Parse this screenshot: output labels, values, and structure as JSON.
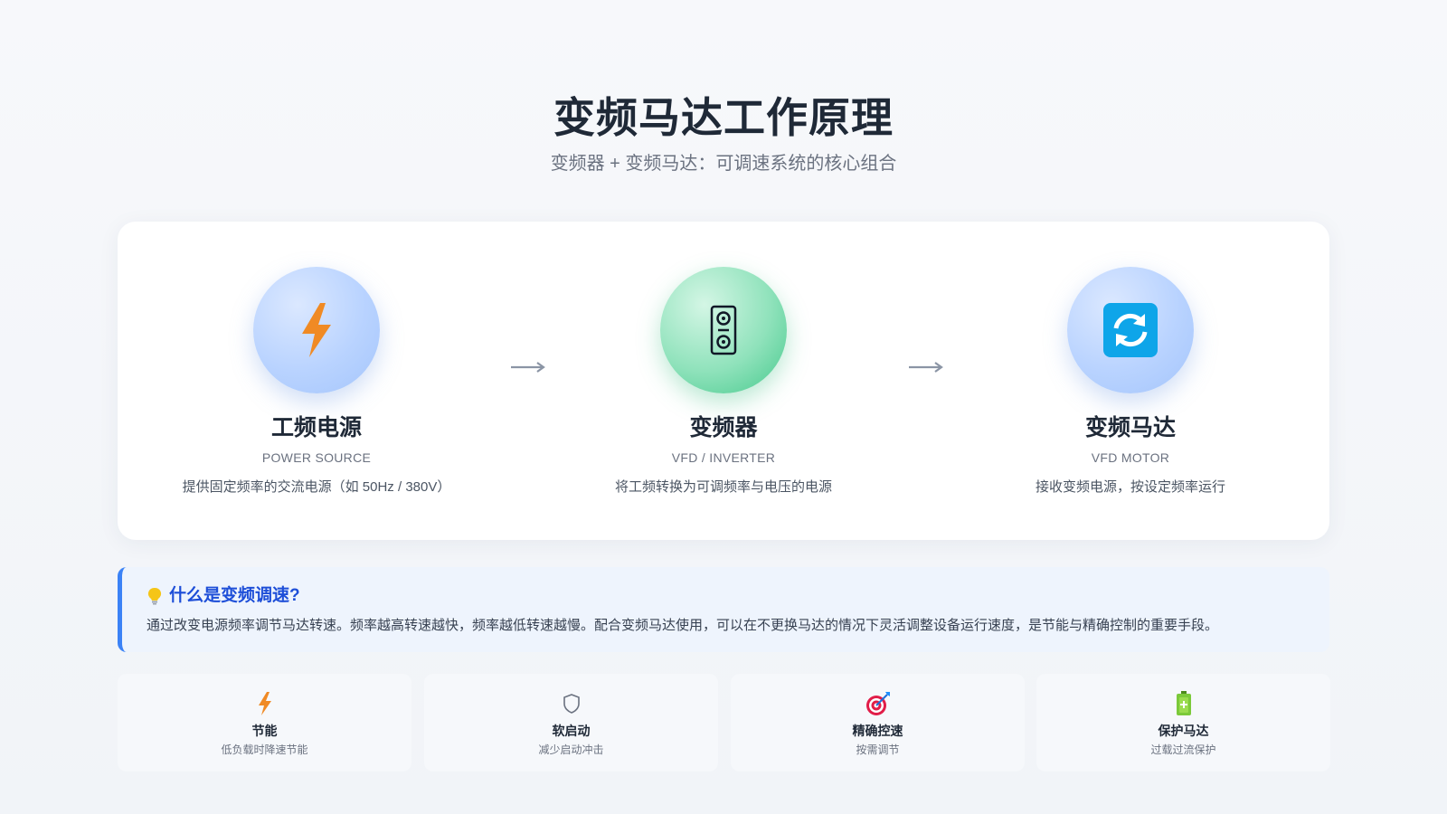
{
  "header": {
    "title": "变频马达工作原理",
    "subtitle": "变频器 + 变频马达：可调速系统的核心组合"
  },
  "flow": {
    "arrow_symbol": "→",
    "steps": [
      {
        "name": "工频电源",
        "en": "POWER SOURCE",
        "desc": "提供固定频率的交流电源（如 50Hz / 380V）",
        "icon": "lightning-icon",
        "accent": "#f08a24"
      },
      {
        "name": "变频器",
        "en": "VFD / INVERTER",
        "desc": "将工频转换为可调频率与电压的电源",
        "icon": "control-knobs-icon",
        "accent": "#2fbf7f"
      },
      {
        "name": "变频马达",
        "en": "VFD MOTOR",
        "desc": "接收变频电源，按设定频率运行",
        "icon": "refresh-icon",
        "accent": "#0ea5e9"
      }
    ]
  },
  "note": {
    "icon": "lightbulb-icon",
    "title": "什么是变频调速?",
    "text": "通过改变电源频率调节马达转速。频率越高转速越快，频率越低转速越慢。配合变频马达使用，可以在不更换马达的情况下灵活调整设备运行速度，是节能与精确控制的重要手段。"
  },
  "features": [
    {
      "name": "节能",
      "desc": "低负载时降速节能",
      "icon": "lightning-icon"
    },
    {
      "name": "软启动",
      "desc": "减少启动冲击",
      "icon": "shield-icon"
    },
    {
      "name": "精确控速",
      "desc": "按需调节",
      "icon": "target-icon"
    },
    {
      "name": "保护马达",
      "desc": "过载过流保护",
      "icon": "battery-icon"
    }
  ]
}
